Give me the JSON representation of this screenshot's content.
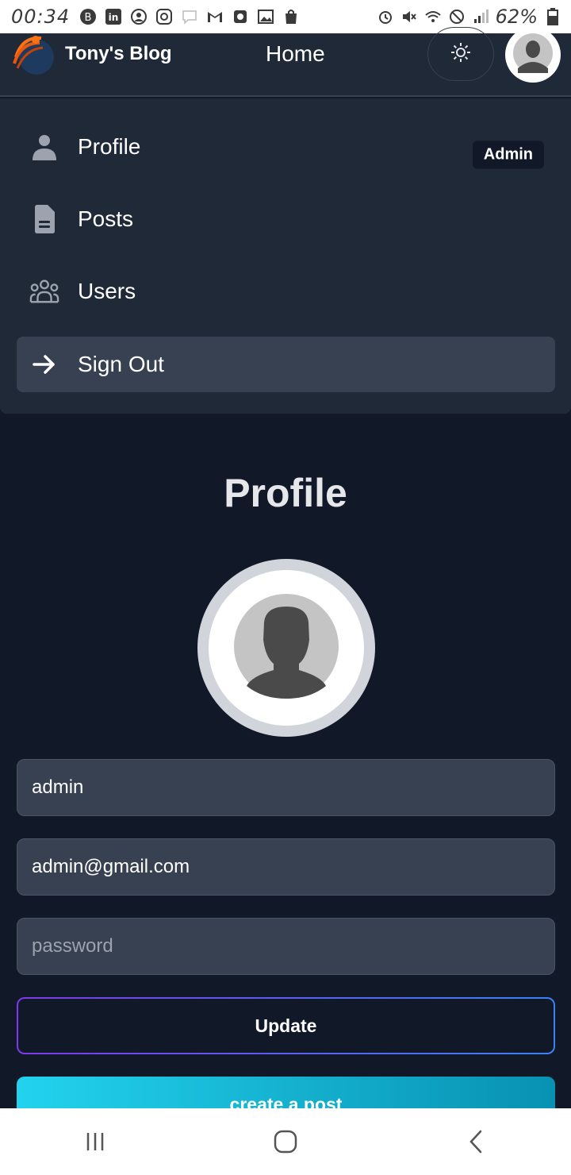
{
  "status_bar": {
    "time": "00:34",
    "battery": "62%",
    "left_icons": [
      "b-circle-icon",
      "linkedin-icon",
      "profile-circle-icon",
      "instagram-icon",
      "chat-icon",
      "gmail-icon",
      "clock-app-icon",
      "gallery-icon",
      "shopping-bag-icon"
    ],
    "right_icons": [
      "alarm-icon",
      "mute-icon",
      "wifi-icon",
      "no-sign-icon",
      "signal-icon"
    ]
  },
  "header": {
    "brand": "Tony's Blog",
    "nav_home": "Home",
    "icons": {
      "theme": "sun-icon",
      "avatar": "user-avatar-icon"
    }
  },
  "menu": {
    "items": [
      {
        "label": "Profile",
        "icon": "person-icon",
        "badge": "Admin"
      },
      {
        "label": "Posts",
        "icon": "document-icon"
      },
      {
        "label": "Users",
        "icon": "users-group-icon"
      },
      {
        "label": "Sign Out",
        "icon": "arrow-right-icon"
      }
    ]
  },
  "main": {
    "title": "Profile",
    "username_value": "admin",
    "email_value": "admin@gmail.com",
    "password_placeholder": "password",
    "update_label": "Update",
    "create_label": "create a post"
  },
  "colors": {
    "background": "#111827",
    "surface": "#1f2937",
    "input": "#374151",
    "gradient_update": [
      "#7c3aed",
      "#3b82f6"
    ],
    "gradient_create": [
      "#22d3ee",
      "#0891b2"
    ],
    "logo_accent": "#f97316"
  },
  "nav_bar": {
    "icons": [
      "recent-apps-icon",
      "home-icon",
      "back-icon"
    ]
  }
}
